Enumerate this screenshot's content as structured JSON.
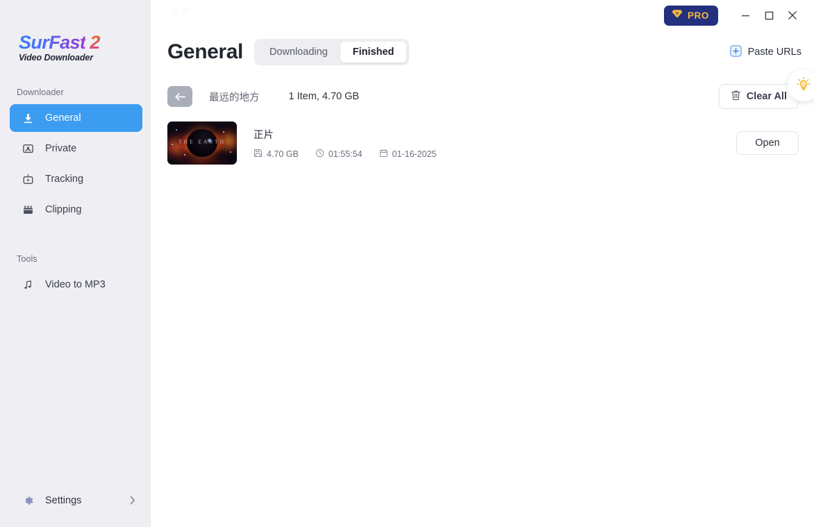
{
  "app": {
    "logo_main": "SurFast",
    "logo_two": "2",
    "logo_sub": "Video Downloader"
  },
  "titlebar": {
    "pro_label": "PRO",
    "pro_icon": "diamond-icon",
    "pro_bg": "#22307e",
    "pro_text_color": "#f5b942",
    "minimize": "minimize-icon",
    "maximize": "maximize-icon",
    "close": "close-icon"
  },
  "sidebar": {
    "bg": "#efeef3",
    "sections": [
      {
        "label": "Downloader",
        "items": [
          {
            "label": "General",
            "icon": "download-arrow-icon",
            "active": true
          },
          {
            "label": "Private",
            "icon": "private-user-icon",
            "active": false
          },
          {
            "label": "Tracking",
            "icon": "tracking-video-icon",
            "active": false
          },
          {
            "label": "Clipping",
            "icon": "clipping-film-icon",
            "active": false
          }
        ]
      },
      {
        "label": "Tools",
        "items": [
          {
            "label": "Video to MP3",
            "icon": "music-note-icon",
            "active": false
          }
        ]
      }
    ],
    "active_bg": "#3c9cf0",
    "settings": {
      "label": "Settings",
      "icon": "gear-icon",
      "chevron": "chevron-right-icon"
    }
  },
  "header": {
    "title": "General",
    "tabs": [
      {
        "label": "Downloading",
        "active": false
      },
      {
        "label": "Finished",
        "active": true
      }
    ],
    "paste_urls": {
      "label": "Paste URLs",
      "icon": "plus-square-icon"
    },
    "tip_button": {
      "icon": "lightbulb-icon",
      "color": "#f5b731"
    }
  },
  "toolbar": {
    "back_icon": "back-arrow-icon",
    "folder_name": "最远的地方",
    "summary": "1 Item, 4.70 GB",
    "clear_all": {
      "label": "Clear All",
      "icon": "trash-icon"
    }
  },
  "list": {
    "items": [
      {
        "thumbnail_alt": "THE EARTH",
        "thumbnail_caption": "THE EARTH",
        "title": "正片",
        "size": "4.70 GB",
        "size_icon": "save-disk-icon",
        "duration": "01:55:54",
        "duration_icon": "clock-icon",
        "date": "01-16-2025",
        "date_icon": "calendar-icon",
        "action_label": "Open"
      }
    ]
  }
}
